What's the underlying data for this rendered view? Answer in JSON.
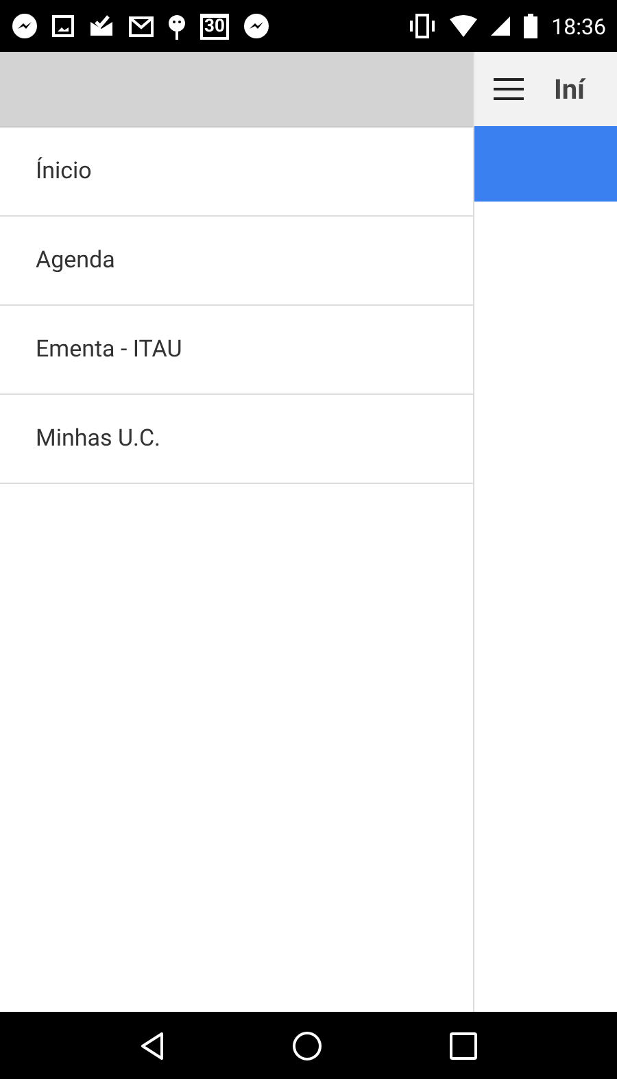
{
  "status_bar": {
    "calendar_day": "30",
    "time": "18:36"
  },
  "drawer": {
    "items": [
      {
        "label": "Ínicio"
      },
      {
        "label": "Agenda"
      },
      {
        "label": "Ementa - ITAU"
      },
      {
        "label": "Minhas U.C."
      }
    ]
  },
  "app_bar": {
    "title": "Iní"
  }
}
